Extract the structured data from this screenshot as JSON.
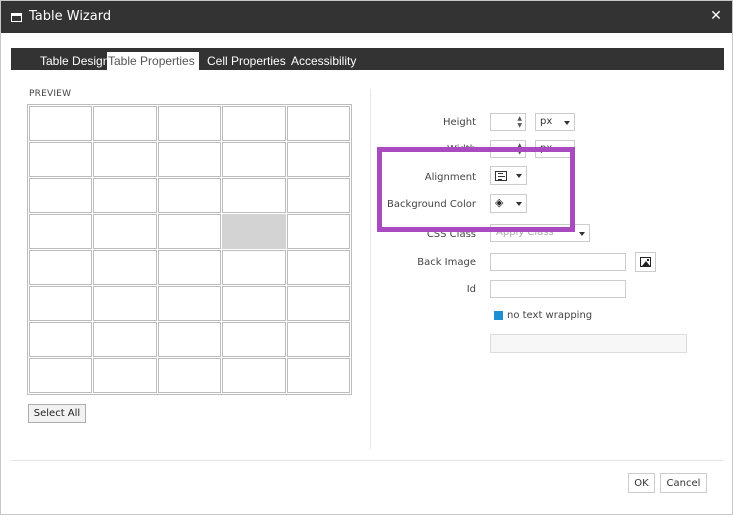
{
  "window": {
    "title": "Table Wizard",
    "close_glyph": "✕",
    "icon": "window-icon"
  },
  "tabs": [
    {
      "label": "Table Design",
      "active": false
    },
    {
      "label": "Table Properties",
      "active": true
    },
    {
      "label": "Cell Properties",
      "active": false
    },
    {
      "label": "Accessibility",
      "active": false
    }
  ],
  "preview": {
    "label": "PREVIEW",
    "rows": 8,
    "cols": 5,
    "selected_cell": {
      "row": 3,
      "col": 3
    },
    "select_all_label": "Select All"
  },
  "properties": {
    "height_label": "Height",
    "height_value": "",
    "height_unit": "px",
    "width_label": "Width",
    "width_value": "",
    "width_unit": "px",
    "alignment_label": "Alignment",
    "alignment_icon": "align-left-icon",
    "background_color_label": "Background Color",
    "background_color_icon": "paint-bucket-icon",
    "css_class_label": "CSS Class",
    "css_class_placeholder": "Apply Class",
    "back_image_label": "Back Image",
    "back_image_value": "",
    "back_image_icon": "image-icon",
    "id_label": "Id",
    "id_value": "",
    "no_text_wrapping_label": "no text wrapping",
    "no_text_wrapping_checked": true
  },
  "colors": {
    "titlebar": "#333333",
    "highlight": "#a94ac0",
    "checkbox": "#1e90d2",
    "selected_cell": "#d3d3d3"
  },
  "footer": {
    "ok_label": "OK",
    "cancel_label": "Cancel"
  }
}
